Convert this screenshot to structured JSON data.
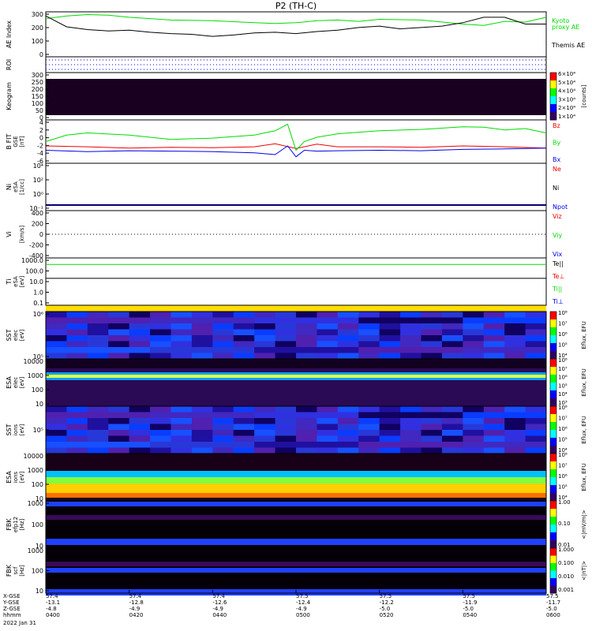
{
  "title": "P2 (TH-C)",
  "footer": {
    "rows": [
      {
        "label": "X-GSE",
        "values": [
          "57.4",
          "57.4",
          "57.4",
          "57.5",
          "57.5",
          "57.5",
          "57.5"
        ]
      },
      {
        "label": "Y-GSE",
        "values": [
          "-13.1",
          "-12.8",
          "-12.6",
          "-12.4",
          "-12.2",
          "-11.9",
          "-11.7"
        ]
      },
      {
        "label": "Z-GSE",
        "values": [
          "-4.8",
          "-4.9",
          "-4.9",
          "-4.9",
          "-5.0",
          "-5.0",
          "-5.0"
        ]
      },
      {
        "label": "hhmm",
        "values": [
          "0400",
          "0420",
          "0440",
          "0500",
          "0520",
          "0540",
          "0600"
        ]
      }
    ],
    "date": "2022 Jan 31"
  },
  "colors": {
    "green": "#00dd00",
    "red": "#ee0000",
    "blue": "#0000ee",
    "black": "#000000",
    "yellow": "#ffdd00"
  },
  "chart_data": {
    "type": "line",
    "x_unit": "hhmm",
    "x_range": [
      "0400",
      "0600"
    ],
    "panels": [
      {
        "id": "ae",
        "ylabel": "AE Index",
        "yticks": [
          "0",
          "100",
          "200",
          "300"
        ],
        "ylim": [
          0,
          330
        ],
        "series": [
          {
            "name": "Kyoto proxy AE",
            "color": "#00dd00",
            "x": [
              0,
              5,
              10,
              15,
              20,
              30,
              40,
              50,
              55,
              60,
              65,
              70,
              75,
              80,
              90,
              100,
              105,
              110,
              115,
              120
            ],
            "y": [
              280,
              300,
              310,
              305,
              290,
              270,
              265,
              250,
              245,
              250,
              265,
              270,
              260,
              275,
              270,
              240,
              230,
              260,
              255,
              290
            ]
          },
          {
            "name": "Themis AE",
            "color": "#000000",
            "x": [
              0,
              5,
              10,
              15,
              20,
              25,
              30,
              35,
              40,
              45,
              50,
              55,
              60,
              65,
              70,
              75,
              80,
              85,
              90,
              95,
              100,
              105,
              110,
              115,
              120
            ],
            "y": [
              300,
              220,
              200,
              190,
              195,
              180,
              170,
              165,
              150,
              160,
              175,
              180,
              170,
              185,
              195,
              215,
              225,
              205,
              215,
              225,
              250,
              290,
              290,
              240,
              240
            ]
          }
        ]
      },
      {
        "id": "roi",
        "ylabel": "ROI",
        "type": "dotted"
      },
      {
        "id": "keogram",
        "ylabel": "Keogram",
        "yticks": [
          "0",
          "50",
          "100",
          "150",
          "200",
          "250",
          "300"
        ],
        "ylim": [
          0,
          300
        ],
        "colorbar": {
          "label": "[counts]",
          "ticks": [
            "1×10⁴",
            "2×10⁴",
            "3×10⁴",
            "4×10⁴",
            "5×10⁴",
            "6×10⁴"
          ]
        }
      },
      {
        "id": "bfit",
        "ylabel": "B FIT",
        "ylabel2": "GSE",
        "unit": "[nT]",
        "yticks": [
          "-6",
          "-4",
          "-2",
          "0",
          "2",
          "4"
        ],
        "ylim": [
          -6,
          4
        ],
        "series": [
          {
            "name": "Bz",
            "color": "#ee0000",
            "x": [
              0,
              10,
              20,
              30,
              40,
              50,
              55,
              60,
              65,
              70,
              80,
              90,
              100,
              110,
              120
            ],
            "y": [
              -2,
              -2.2,
              -2.5,
              -2.3,
              -2.4,
              -2.2,
              -1.5,
              -2.6,
              -1.6,
              -2.2,
              -2.2,
              -2.3,
              -2,
              -2.2,
              -2.5
            ]
          },
          {
            "name": "By",
            "color": "#00dd00",
            "x": [
              0,
              5,
              10,
              20,
              30,
              40,
              50,
              55,
              58,
              60,
              62,
              65,
              70,
              80,
              90,
              100,
              105,
              110,
              115,
              120
            ],
            "y": [
              -1,
              0.5,
              1,
              0.5,
              -0.5,
              -0.2,
              0.5,
              1.5,
              3,
              -3,
              -1,
              0,
              0.8,
              1.5,
              1.8,
              2.4,
              2.3,
              1.7,
              2,
              1
            ]
          },
          {
            "name": "Bx",
            "color": "#0000ee",
            "x": [
              0,
              10,
              20,
              30,
              40,
              50,
              55,
              58,
              60,
              62,
              65,
              70,
              80,
              90,
              100,
              110,
              120
            ],
            "y": [
              -3,
              -3.3,
              -3.1,
              -3.2,
              -3.3,
              -3.6,
              -4,
              -2,
              -4.5,
              -3,
              -3.2,
              -3.1,
              -3,
              -3.1,
              -2.8,
              -2.7,
              -2.5
            ]
          }
        ],
        "legend": [
          {
            "name": "Bz",
            "color": "#ee0000"
          },
          {
            "name": "By",
            "color": "#00dd00"
          },
          {
            "name": "Bx",
            "color": "#0000ee"
          }
        ]
      },
      {
        "id": "ni",
        "ylabel": "Ni",
        "ylabel2": "eSA",
        "unit": "[1/cc]",
        "yticks": [
          "10⁻¹",
          "10⁰",
          "10²",
          "10⁴"
        ],
        "ylim": [
          -1,
          5
        ],
        "series": [
          {
            "name": "Ne",
            "color": "#ee0000",
            "x": [
              0,
              120
            ],
            "y": [
              -0.3,
              -0.3
            ]
          },
          {
            "name": "Ni",
            "color": "#000000",
            "x": [
              0,
              120
            ],
            "y": [
              -0.25,
              -0.25
            ]
          },
          {
            "name": "Npot",
            "color": "#0000ee",
            "x": [
              0,
              120
            ],
            "y": [
              -0.35,
              -0.35
            ]
          }
        ],
        "legend": [
          {
            "name": "Ne",
            "color": "#ee0000"
          },
          {
            "name": "Ni",
            "color": "#000000"
          },
          {
            "name": "Npot",
            "color": "#0000ee"
          }
        ]
      },
      {
        "id": "vi",
        "ylabel": "Vi",
        "unit": "[km/s]",
        "yticks": [
          "-400",
          "-200",
          "0",
          "200",
          "400"
        ],
        "ylim": [
          -500,
          500
        ],
        "legend": [
          {
            "name": "Viz",
            "color": "#ee0000"
          },
          {
            "name": "Viy",
            "color": "#00dd00"
          },
          {
            "name": "Vix",
            "color": "#0000ee"
          }
        ]
      },
      {
        "id": "ti",
        "ylabel": "Ti",
        "ylabel2": "eSA",
        "unit": "[eV]",
        "yticks": [
          "0.1",
          "1.0",
          "10.0",
          "100.0",
          "1000.0"
        ],
        "ylim": [
          -1.3,
          3.8
        ],
        "series": [
          {
            "name": "Ti||",
            "color": "#00dd00",
            "x": [
              0,
              120
            ],
            "y": [
              3.1,
              3.1
            ]
          },
          {
            "name": "Te||",
            "color": "#000000",
            "x": [
              0,
              120
            ],
            "y": [
              1.6,
              1.6
            ]
          }
        ],
        "legend": [
          {
            "name": "Te||",
            "color": "#000000"
          },
          {
            "name": "Te⊥",
            "color": "#ee0000"
          },
          {
            "name": "Ti||",
            "color": "#00dd00"
          },
          {
            "name": "Ti⊥",
            "color": "#0000ee"
          }
        ]
      },
      {
        "id": "sst_e",
        "ylabel": "SST",
        "ylabel2": "elec",
        "unit": "[eV]",
        "yticks": [
          "10⁵",
          "10⁶"
        ],
        "colorbar": {
          "label": "Eflux, EFU",
          "ticks": [
            "10⁴",
            "10⁵",
            "10⁶",
            "10⁷",
            "10⁸"
          ]
        }
      },
      {
        "id": "esa_e",
        "ylabel": "ESA",
        "ylabel2": "elec",
        "unit": "[eV]",
        "yticks": [
          "10",
          "100",
          "1000",
          "10000"
        ],
        "colorbar": {
          "label": "Eflux, EFU",
          "ticks": [
            "10³",
            "10⁴",
            "10⁵",
            "10⁶",
            "10⁷",
            "10⁸"
          ]
        }
      },
      {
        "id": "sst_i",
        "ylabel": "SST",
        "ylabel2": "ions",
        "unit": "[eV]",
        "yticks": [
          "10⁵"
        ],
        "colorbar": {
          "label": "Eflux, EFU",
          "ticks": [
            "10⁴",
            "10⁵",
            "10⁶",
            "10⁷",
            "10⁸"
          ]
        }
      },
      {
        "id": "esa_i",
        "ylabel": "ESA",
        "ylabel2": "ions",
        "unit": "[eV]",
        "yticks": [
          "10",
          "100",
          "1000",
          "10000"
        ],
        "colorbar": {
          "label": "Eflux, EFU",
          "ticks": [
            "10⁴",
            "10⁵",
            "10⁶",
            "10⁷",
            "10⁸"
          ]
        }
      },
      {
        "id": "fbk_e",
        "ylabel": "FBK",
        "ylabel2": "efp12",
        "unit": "[Hz]",
        "yticks": [
          "10",
          "100",
          "1000"
        ],
        "colorbar": {
          "label": "<|mV/m|>",
          "ticks": [
            "0.01",
            "0.10",
            "1.00"
          ]
        }
      },
      {
        "id": "fbk_b",
        "ylabel": "FBK",
        "ylabel2": "scf",
        "unit": "[Hz]",
        "yticks": [
          "10",
          "100",
          "1000"
        ],
        "colorbar": {
          "label": "<|nT|>",
          "ticks": [
            "0.001",
            "0.010",
            "0.100",
            "1.000"
          ]
        }
      }
    ]
  }
}
